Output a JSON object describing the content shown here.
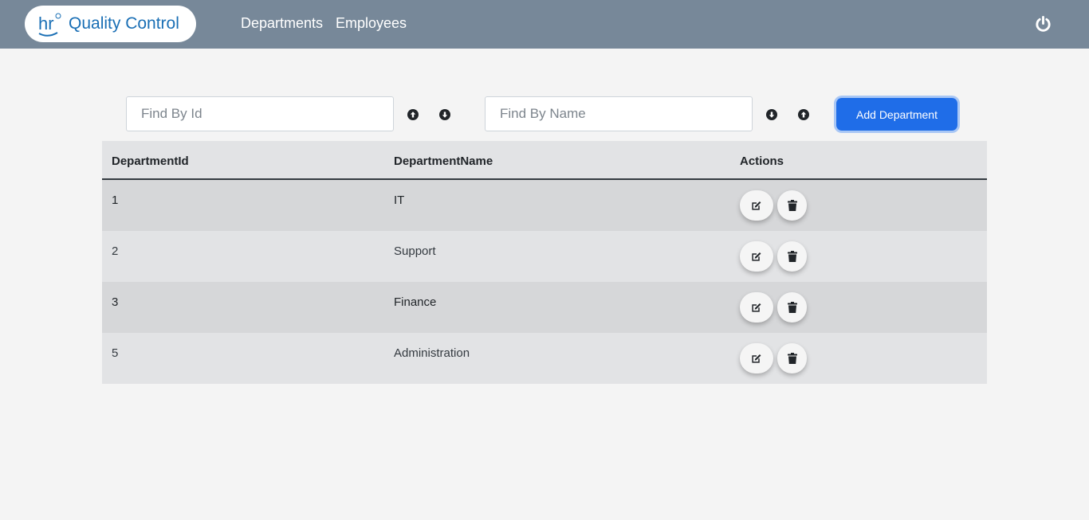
{
  "header": {
    "brand_title": "Quality Control",
    "logo_icon": "hr-logo",
    "nav": [
      {
        "label": "Departments"
      },
      {
        "label": "Employees"
      }
    ],
    "logout_icon": "power-icon"
  },
  "filters": {
    "find_by_id_placeholder": "Find By Id",
    "find_by_id_value": "",
    "find_by_name_placeholder": "Find By Name",
    "find_by_name_value": "",
    "add_button_label": "Add Department"
  },
  "table": {
    "columns": [
      "DepartmentId",
      "DepartmentName",
      "Actions"
    ],
    "rows": [
      {
        "id": "1",
        "name": "IT"
      },
      {
        "id": "2",
        "name": "Support"
      },
      {
        "id": "3",
        "name": "Finance"
      },
      {
        "id": "5",
        "name": "Administration"
      }
    ],
    "row_actions": [
      "edit-icon",
      "trash-icon"
    ]
  },
  "colors": {
    "navbar": "#778899",
    "accent": "#1f6de8",
    "brand_text": "#1a6fb5"
  }
}
